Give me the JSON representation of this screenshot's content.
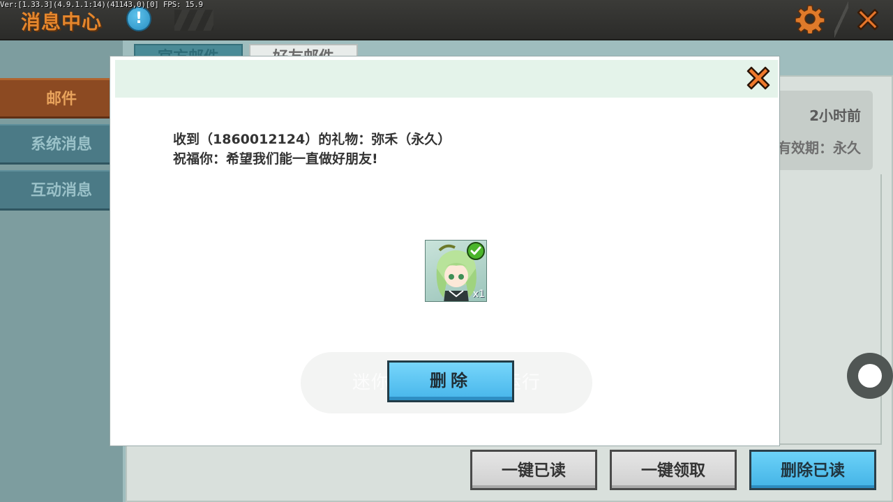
{
  "topbar": {
    "debug_text": "Ver:[1.33.3](4.9.1.1:14)(41143,0)[0] FPS: 15.9",
    "title": "消息中心",
    "info_badge": "!",
    "icons": {
      "settings": "gear-icon",
      "close": "close-icon"
    },
    "accent_color": "#e5862c"
  },
  "sidebar": {
    "items": [
      {
        "label": "邮件",
        "active": true
      },
      {
        "label": "系统消息",
        "active": false
      },
      {
        "label": "互动消息",
        "active": false
      }
    ]
  },
  "tabs": [
    {
      "label": "官方邮件",
      "active": true
    },
    {
      "label": "好友邮件",
      "active": false
    }
  ],
  "mail_list": {
    "time": "2小时前",
    "validity": "有效期：永久"
  },
  "bottom_buttons": [
    {
      "label": "一键已读",
      "style": "gray"
    },
    {
      "label": "一键领取",
      "style": "gray"
    },
    {
      "label": "删除已读",
      "style": "blue"
    }
  ],
  "modal": {
    "line1": "收到（1860012124）的礼物：弥禾（永久）",
    "line2": "祝福你：希望我们能一直做好朋友!",
    "gift": {
      "name": "弥禾",
      "quantity": "x1",
      "claimed": true
    },
    "toast": "迷你世界已在后台运行",
    "delete_label": "删除"
  }
}
